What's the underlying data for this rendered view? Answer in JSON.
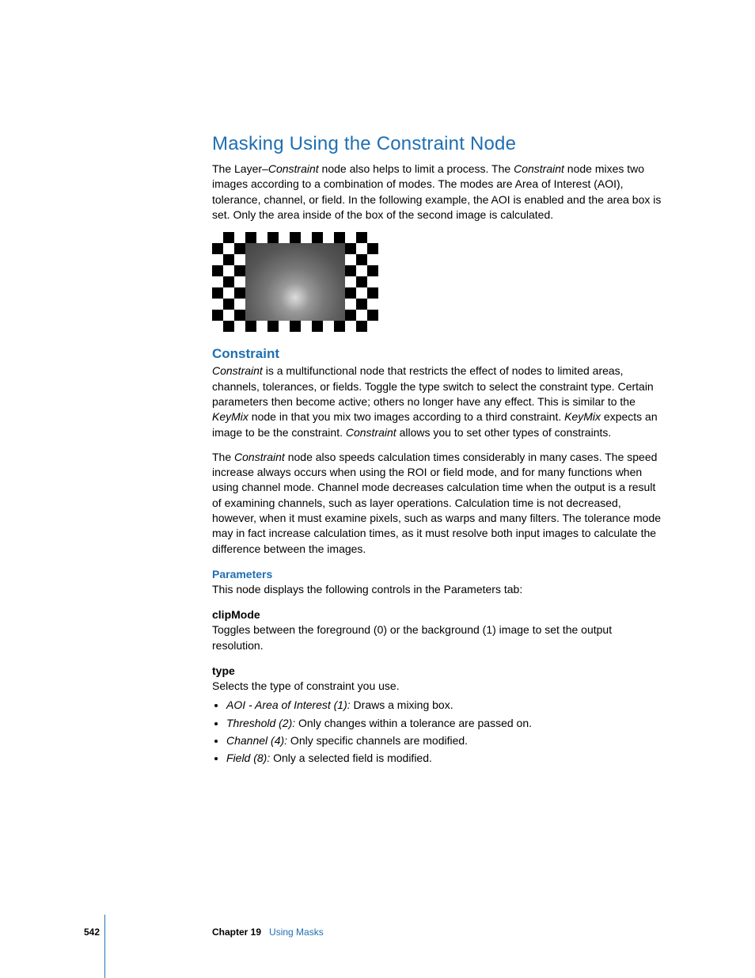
{
  "heading1": "Masking Using the Constraint Node",
  "intro_parts": [
    "The Layer–",
    "Constraint",
    " node also helps to limit a process. The ",
    "Constraint",
    " node mixes two images according to a combination of modes. The modes are Area of Interest (AOI), tolerance, channel, or field. In the following example, the AOI is enabled and the area box is set. Only the area inside of the box of the second image is calculated."
  ],
  "heading2": "Constraint",
  "para2a_parts": [
    "Constraint",
    " is a multifunctional node that restricts the effect of nodes to limited areas, channels, tolerances, or fields. Toggle the type switch to select the constraint type. Certain parameters then become active; others no longer have any effect. This is similar to the ",
    "KeyMix",
    " node in that you mix two images according to a third constraint. ",
    "KeyMix",
    " expects an image to be the constraint. ",
    "Constraint",
    " allows you to set other types of constraints."
  ],
  "para2b_parts": [
    "The ",
    "Constraint",
    " node also speeds calculation times considerably in many cases. The speed increase always occurs when using the ROI or field mode, and for many functions when using channel mode. Channel mode decreases calculation time when the output is a result of examining channels, such as layer operations. Calculation time is not decreased, however, when it must examine pixels, such as warps and many filters. The tolerance mode may in fact increase calculation times, as it must resolve both input images to calculate the difference between the images."
  ],
  "parameters_heading": "Parameters",
  "parameters_intro": "This node displays the following controls in the Parameters tab:",
  "clipmode_heading": "clipMode",
  "clipmode_text": "Toggles between the foreground (0) or the background (1) image to set the output resolution.",
  "type_heading": "type",
  "type_intro": "Selects the type of constraint you use.",
  "type_items": [
    {
      "term": "AOI - Area of Interest (1):",
      "desc": "  Draws a mixing box."
    },
    {
      "term": "Threshold (2):",
      "desc": "  Only changes within a tolerance are passed on."
    },
    {
      "term": "Channel (4):",
      "desc": "  Only specific channels are modified."
    },
    {
      "term": "Field (8):",
      "desc": "  Only a selected field is modified."
    }
  ],
  "footer": {
    "page": "542",
    "chapter_label": "Chapter 19",
    "chapter_title": "Using Masks"
  }
}
